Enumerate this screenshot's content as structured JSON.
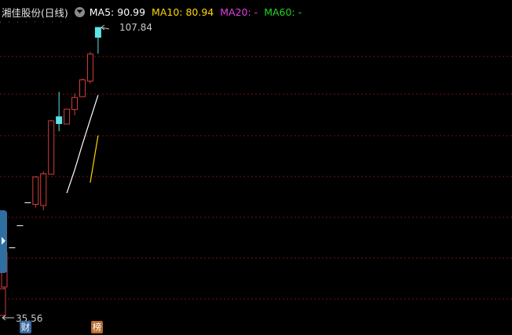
{
  "header": {
    "title": "湘佳股份(日线)",
    "settings_icon": "chevron-down-icon",
    "ma5": "MA5: 90.99",
    "ma10": "MA10: 80.94",
    "ma20": "MA20: -",
    "ma60": "MA60: -"
  },
  "labels": {
    "high": "107.84",
    "low": "35.56"
  },
  "badges": {
    "fin": "财",
    "list": "榜"
  },
  "colors": {
    "background": "#000000",
    "grid": "#7a0f0f",
    "up": "#d23c3c",
    "down": "#5fe5e5",
    "ma5": "#ffffff",
    "ma10": "#ffd700",
    "ma20": "#e040e0",
    "ma60": "#22d422"
  },
  "chart_data": {
    "type": "candlestick",
    "title": "湘佳股份(日线)",
    "price_range": [
      35.56,
      107.84
    ],
    "candles": [
      {
        "open": 43.2,
        "high": 52.5,
        "low": 35.56,
        "close": 51.8,
        "dir": "up"
      },
      {
        "open": 53.0,
        "high": 53.0,
        "low": 53.0,
        "close": 53.0,
        "dir": "flat"
      },
      {
        "open": 58.5,
        "high": 58.5,
        "low": 58.5,
        "close": 58.5,
        "dir": "flat"
      },
      {
        "open": 64.2,
        "high": 64.2,
        "low": 64.2,
        "close": 64.2,
        "dir": "flat"
      },
      {
        "open": 63.8,
        "high": 70.8,
        "low": 63.0,
        "close": 70.6,
        "dir": "up"
      },
      {
        "open": 63.5,
        "high": 72.0,
        "low": 62.3,
        "close": 71.4,
        "dir": "up"
      },
      {
        "open": 71.3,
        "high": 84.8,
        "low": 71.3,
        "close": 84.6,
        "dir": "up"
      },
      {
        "open": 85.6,
        "high": 91.8,
        "low": 82.0,
        "close": 83.9,
        "dir": "down"
      },
      {
        "open": 83.8,
        "high": 87.6,
        "low": 83.8,
        "close": 87.5,
        "dir": "up"
      },
      {
        "open": 87.4,
        "high": 91.4,
        "low": 86.0,
        "close": 90.4,
        "dir": "up"
      },
      {
        "open": 90.6,
        "high": 95.2,
        "low": 90.6,
        "close": 94.8,
        "dir": "up"
      },
      {
        "open": 94.5,
        "high": 101.8,
        "low": 93.9,
        "close": 101.2,
        "dir": "up"
      },
      {
        "open": 107.84,
        "high": 107.84,
        "low": 101.3,
        "close": 105.4,
        "dir": "down"
      }
    ],
    "ma5": [
      [
        8,
        66.6
      ],
      [
        9,
        72.3
      ],
      [
        10,
        78.8
      ],
      [
        11,
        84.9
      ],
      [
        12,
        90.99
      ]
    ],
    "ma10": [
      [
        11,
        69.2
      ],
      [
        12,
        80.94
      ]
    ],
    "ma20": [],
    "ma60": []
  }
}
